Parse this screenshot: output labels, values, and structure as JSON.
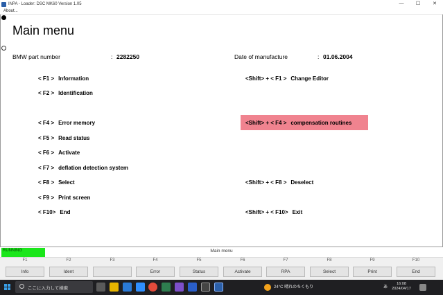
{
  "window": {
    "title": "INPA - Loader:  DSC MK60 Version 1.05",
    "menu": "About...",
    "controls": [
      "—",
      "☐",
      "✕"
    ]
  },
  "main": {
    "title": "Main menu",
    "part_label": "BMW part number",
    "part_colon": ":",
    "part_value": "2282250",
    "date_label": "Date of manufacture",
    "date_colon": ":",
    "date_value": "01.06.2004",
    "menu_left": [
      {
        "key": "< F1 >",
        "label": "Information"
      },
      {
        "key": "< F2 >",
        "label": "Identification"
      },
      {
        "key": "< F4 >",
        "label": "Error memory"
      },
      {
        "key": "< F5 >",
        "label": "Read status"
      },
      {
        "key": "< F6 >",
        "label": "Activate"
      },
      {
        "key": "< F7 >",
        "label": "deflation detection system"
      },
      {
        "key": "< F8 >",
        "label": "Select"
      },
      {
        "key": "< F9 >",
        "label": "Print screen"
      },
      {
        "key": "< F10>",
        "label": "End"
      }
    ],
    "menu_right": [
      {
        "key": "<Shift> + < F1 >",
        "label": "Change Editor"
      },
      {
        "key": "<Shift> + < F4 >",
        "label": "compensation routines"
      },
      {
        "key": "<Shift> + < F8 >",
        "label": "Deselect"
      },
      {
        "key": "<Shift> + < F10>",
        "label": "Exit"
      }
    ],
    "highlight_color": "#f0838f"
  },
  "status": {
    "running": "RUNNING",
    "center": "Main menu",
    "running_color": "#1be61b"
  },
  "fkeys": [
    {
      "num": "F1",
      "label": "Info"
    },
    {
      "num": "F2",
      "label": "Ident"
    },
    {
      "num": "F3",
      "label": ""
    },
    {
      "num": "F4",
      "label": "Error"
    },
    {
      "num": "F5",
      "label": "Status"
    },
    {
      "num": "F6",
      "label": "Activate"
    },
    {
      "num": "F7",
      "label": "RPA"
    },
    {
      "num": "F8",
      "label": "Select"
    },
    {
      "num": "F9",
      "label": "Print"
    },
    {
      "num": "F10",
      "label": "End"
    }
  ],
  "taskbar": {
    "search_placeholder": "ここに入力して検索",
    "weather": "24°C  晴れのちくもり",
    "time": "16:08",
    "date": "2024/04/17",
    "ime": "あ"
  }
}
